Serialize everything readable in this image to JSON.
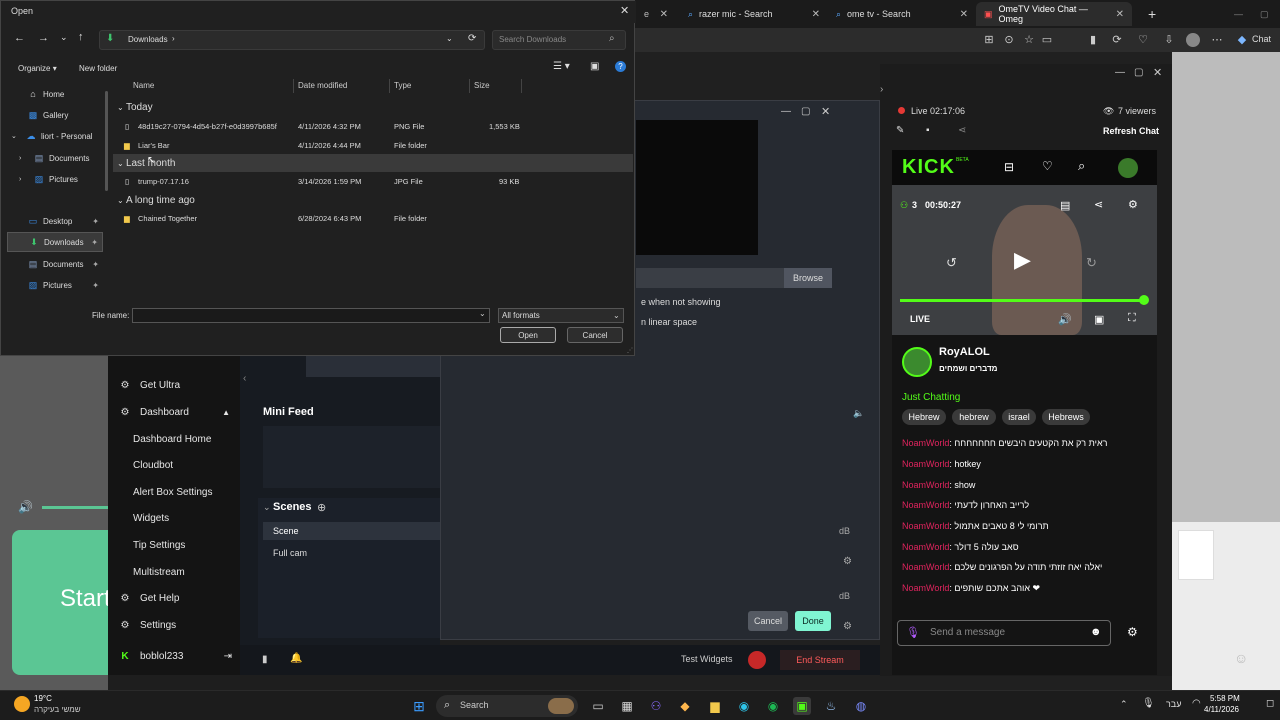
{
  "browser": {
    "tabs": [
      {
        "label": "razer mic - Search"
      },
      {
        "label": "ome tv - Search"
      },
      {
        "label": "OmeTV Video Chat — Omeg"
      }
    ],
    "chat_button": "Chat"
  },
  "kick": {
    "logo": "KICK",
    "beta": "BETA",
    "live_time": "Live 02:17:06",
    "viewers": "7 viewers",
    "refresh_chat": "Refresh Chat",
    "viewer_count_small": "3",
    "stream_time": "00:50:27",
    "live_label": "LIVE",
    "progress": 1.0,
    "streamer": "RoyALOL",
    "streamer_sub": "מדברים ושמחים",
    "category": "Just Chatting",
    "tags": [
      "Hebrew",
      "hebrew",
      "israel",
      "Hebrews"
    ],
    "messages": [
      {
        "user": "NoamWorld",
        "text": ": ראית רק את הקטעים היבשים חחחחחחח"
      },
      {
        "user": "NoamWorld",
        "text": ": hotkey"
      },
      {
        "user": "NoamWorld",
        "text": ": show"
      },
      {
        "user": "NoamWorld",
        "text": ": לרייב האחרון לדעתי"
      },
      {
        "user": "NoamWorld",
        "text": ": תרומי לי 8 טאבים אתמול"
      },
      {
        "user": "NoamWorld",
        "text": ": סאב עולה 5 דולר"
      },
      {
        "user": "NoamWorld",
        "text": ": יאלה יאח זוזתי תודה על הפרגונים שלכם"
      },
      {
        "user": "NoamWorld",
        "text": ": אוהב אתכם שותפים ❤"
      }
    ],
    "send_placeholder": "Send a message"
  },
  "app": {
    "sidebar": [
      {
        "label": "Get Ultra",
        "icon": "gear-star-icon"
      },
      {
        "label": "Dashboard",
        "icon": "dashboard-icon"
      },
      {
        "label": "Dashboard Home",
        "icon": ""
      },
      {
        "label": "Cloudbot",
        "icon": ""
      },
      {
        "label": "Alert Box Settings",
        "icon": ""
      },
      {
        "label": "Widgets",
        "icon": ""
      },
      {
        "label": "Tip Settings",
        "icon": ""
      },
      {
        "label": "Multistream",
        "icon": ""
      },
      {
        "label": "Get Help",
        "icon": "help-icon"
      },
      {
        "label": "Settings",
        "icon": "gear-icon"
      },
      {
        "label": "boblol233",
        "icon": "kick-icon"
      }
    ],
    "mini_feed": "Mini Feed",
    "scenes_title": "Scenes",
    "scenes": [
      "Scene",
      "Full cam"
    ],
    "start_text": "Start",
    "test_widgets": "Test Widgets",
    "end_stream": "End Stream",
    "widget_dialog": {
      "browse": "Browse",
      "opt1": "e when not showing",
      "opt2": "n linear space",
      "cancel": "Cancel",
      "done": "Done",
      "db1": "dB",
      "db2": "dB"
    }
  },
  "dialog": {
    "title": "Open",
    "path": "Downloads",
    "search_placeholder": "Search Downloads",
    "organize": "Organize",
    "new_folder": "New folder",
    "nav": [
      {
        "label": "Home",
        "icon": "home-icon"
      },
      {
        "label": "Gallery",
        "icon": "gallery-icon"
      },
      {
        "label": "liort - Personal",
        "icon": "cloud-icon"
      },
      {
        "label": "Documents",
        "icon": "documents-icon"
      },
      {
        "label": "Pictures",
        "icon": "pictures-icon"
      },
      {
        "label": "Desktop",
        "icon": "desktop-icon"
      },
      {
        "label": "Downloads",
        "icon": "downloads-icon"
      },
      {
        "label": "Documents",
        "icon": "documents-icon"
      },
      {
        "label": "Pictures",
        "icon": "pictures-icon"
      }
    ],
    "columns": [
      "Name",
      "Date modified",
      "Type",
      "Size"
    ],
    "groups": [
      "Today",
      "Last month",
      "A long time ago"
    ],
    "files": [
      {
        "name": "48d19c27-0794-4d54-b27f-e0d3997b685f",
        "date": "4/11/2026 4:32 PM",
        "type": "PNG File",
        "size": "1,553 KB",
        "icon": "image-file-icon"
      },
      {
        "name": "Liar's Bar",
        "date": "4/11/2026 4:44 PM",
        "type": "File folder",
        "size": "",
        "icon": "folder-icon"
      },
      {
        "name": "trump-07.17.16",
        "date": "3/14/2026 1:59 PM",
        "type": "JPG File",
        "size": "93 KB",
        "icon": "image-file-icon"
      },
      {
        "name": "Chained Together",
        "date": "6/28/2024 6:43 PM",
        "type": "File folder",
        "size": "",
        "icon": "folder-icon"
      }
    ],
    "file_name_label": "File name:",
    "file_name_value": "",
    "filter": "All formats",
    "open": "Open",
    "cancel": "Cancel"
  },
  "taskbar": {
    "weather_temp": "19°C",
    "weather_desc": "שמשי בעיקרה",
    "search": "Search",
    "lang": "עבר",
    "time": "5:58 PM",
    "date": "4/11/2026"
  }
}
